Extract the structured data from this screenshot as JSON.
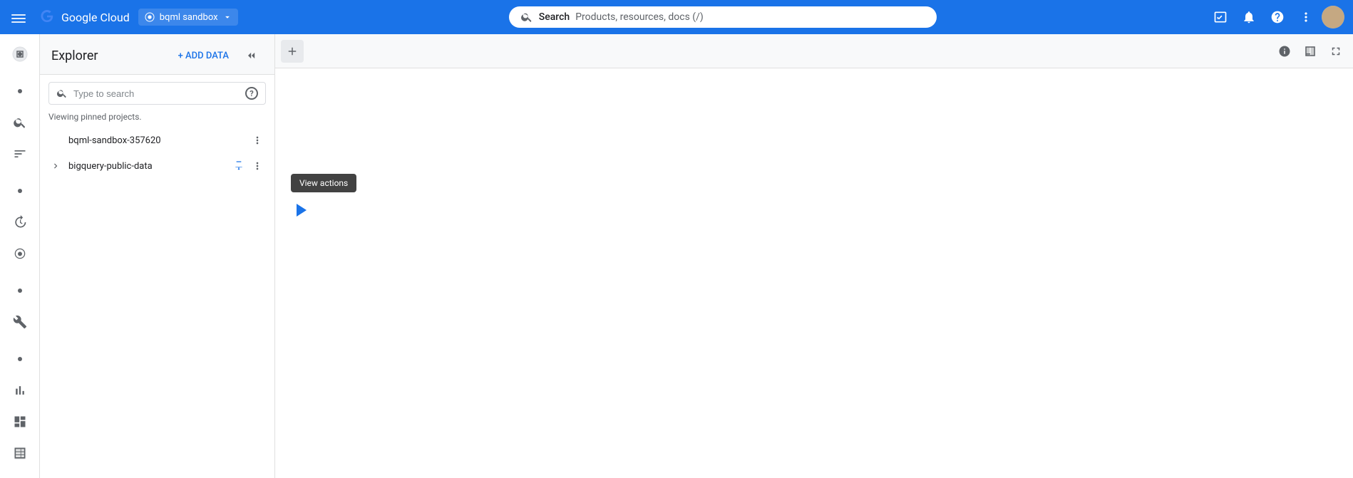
{
  "topNav": {
    "hamburger_label": "☰",
    "logo_text": "Google Cloud",
    "project_name": "bqml sandbox",
    "search_placeholder": "Search",
    "search_hint": "Products, resources, docs (/)",
    "icons": {
      "terminal": "⬜",
      "notification": "🔔",
      "help": "❓",
      "more": "⋮"
    }
  },
  "explorerPanel": {
    "title": "Explorer",
    "add_data_label": "+ ADD DATA",
    "search_placeholder": "Type to search",
    "viewing_text": "Viewing pinned projects.",
    "projects": [
      {
        "id": "bqml-sandbox-357620",
        "name": "bqml-sandbox-357620",
        "expandable": false,
        "pinned": false
      },
      {
        "id": "bigquery-public-data",
        "name": "bigquery-public-data",
        "expandable": true,
        "pinned": true
      }
    ]
  },
  "contentArea": {
    "tooltip_text": "View actions",
    "play_color": "#1a73e8",
    "play_color2": "#ea4335"
  },
  "toolbar": {
    "add_tab_icon": "+",
    "info_icon": "ℹ",
    "grid_icon": "⊞",
    "expand_icon": "⛶"
  },
  "sidebar": {
    "items": [
      {
        "icon": "●",
        "name": "dot-1",
        "active": false
      },
      {
        "icon": "search",
        "name": "search",
        "active": false
      },
      {
        "icon": "≡",
        "name": "filter",
        "active": false
      },
      {
        "icon": "●",
        "name": "dot-2",
        "active": false
      },
      {
        "icon": "⏱",
        "name": "history",
        "active": false
      },
      {
        "icon": "◎",
        "name": "analytics",
        "active": false
      },
      {
        "icon": "●",
        "name": "dot-3",
        "active": false
      },
      {
        "icon": "🔧",
        "name": "tools",
        "active": false
      },
      {
        "icon": "●",
        "name": "dot-4",
        "active": false
      },
      {
        "icon": "📊",
        "name": "chart",
        "active": false
      },
      {
        "icon": "⊞",
        "name": "dashboard",
        "active": false
      },
      {
        "icon": "⊟",
        "name": "table",
        "active": false
      }
    ]
  }
}
